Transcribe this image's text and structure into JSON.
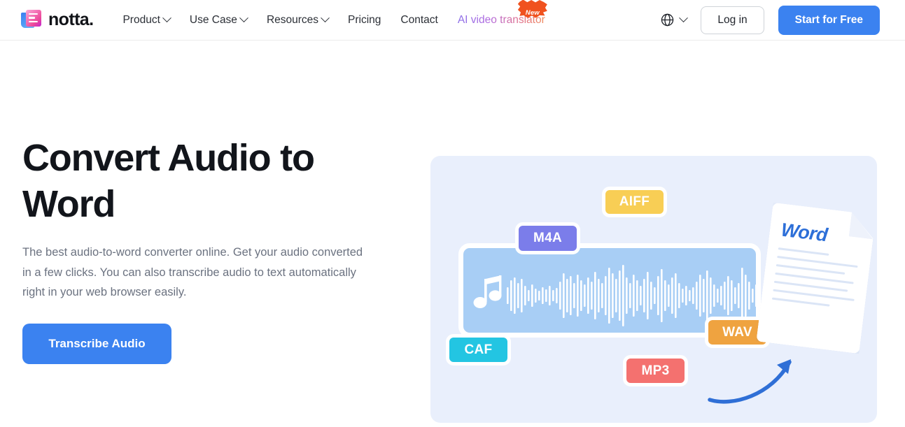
{
  "header": {
    "logo": {
      "text": "notta.",
      "icon": "notta-logo-icon"
    },
    "nav": [
      {
        "label": "Product",
        "has_dropdown": true
      },
      {
        "label": "Use Case",
        "has_dropdown": true
      },
      {
        "label": "Resources",
        "has_dropdown": true
      },
      {
        "label": "Pricing",
        "has_dropdown": false
      },
      {
        "label": "Contact",
        "has_dropdown": false
      }
    ],
    "promo": {
      "label": "AI video translator",
      "badge": "New"
    },
    "language": {
      "icon": "globe-icon"
    },
    "login_label": "Log in",
    "start_label": "Start for Free"
  },
  "hero": {
    "title": "Convert Audio to Word",
    "subtitle": "The best audio-to-word converter online. Get your audio converted in a few clicks. You can also transcribe audio to text automatically right in your web browser easily.",
    "cta_label": "Transcribe Audio"
  },
  "illustration": {
    "audio_card": {
      "icon": "music-note-icon",
      "waveform": "audio-waveform"
    },
    "format_tags": [
      {
        "label": "AIFF",
        "color": "#f8ce55"
      },
      {
        "label": "M4A",
        "color": "#7b7dea"
      },
      {
        "label": "CAF",
        "color": "#23c5e2"
      },
      {
        "label": "WAV",
        "color": "#efa340"
      },
      {
        "label": "MP3",
        "color": "#f4716f"
      }
    ],
    "document": {
      "label": "Word",
      "icon": "word-document-icon"
    },
    "arrow": {
      "icon": "curved-arrow-icon"
    }
  },
  "colors": {
    "primary": "#3b82f0",
    "title": "#12151b",
    "body_text": "#6b7280",
    "panel_bg": "#e9effc",
    "audio_card": "#a8cef5"
  }
}
